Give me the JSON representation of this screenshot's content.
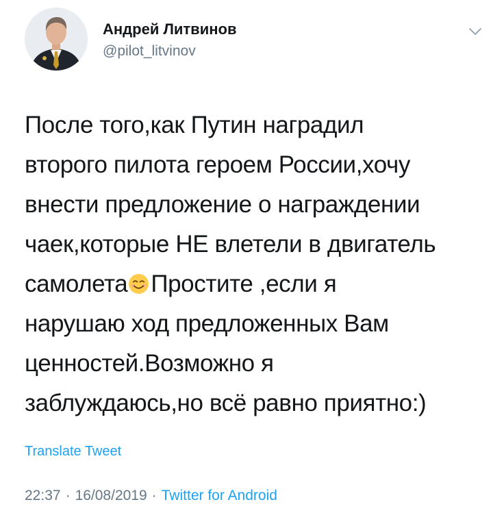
{
  "author": {
    "name": "Андрей Литвинов",
    "handle": "@pilot_litvinov"
  },
  "icons": {
    "menu": "chevron-down-icon",
    "emoji": "smiling-face-icon"
  },
  "tweet": {
    "lines": [
      "После того,как Путин наградил",
      "второго пилота героем России,хочу",
      "внести предложение о награждении",
      "чаек,которые НЕ влетели в двигатель",
      "самолета",
      "Простите ,если я",
      "нарушаю ход предложенных Вам",
      "ценностей.Возможно я",
      "заблуждаюсь,но всё равно приятно:)"
    ]
  },
  "translate_label": "Translate Tweet",
  "meta": {
    "time": "22:37",
    "date": "16/08/2019",
    "separator": "·",
    "source": "Twitter for Android"
  },
  "colors": {
    "text": "#14171a",
    "secondary": "#657786",
    "link": "#1da1f2"
  }
}
